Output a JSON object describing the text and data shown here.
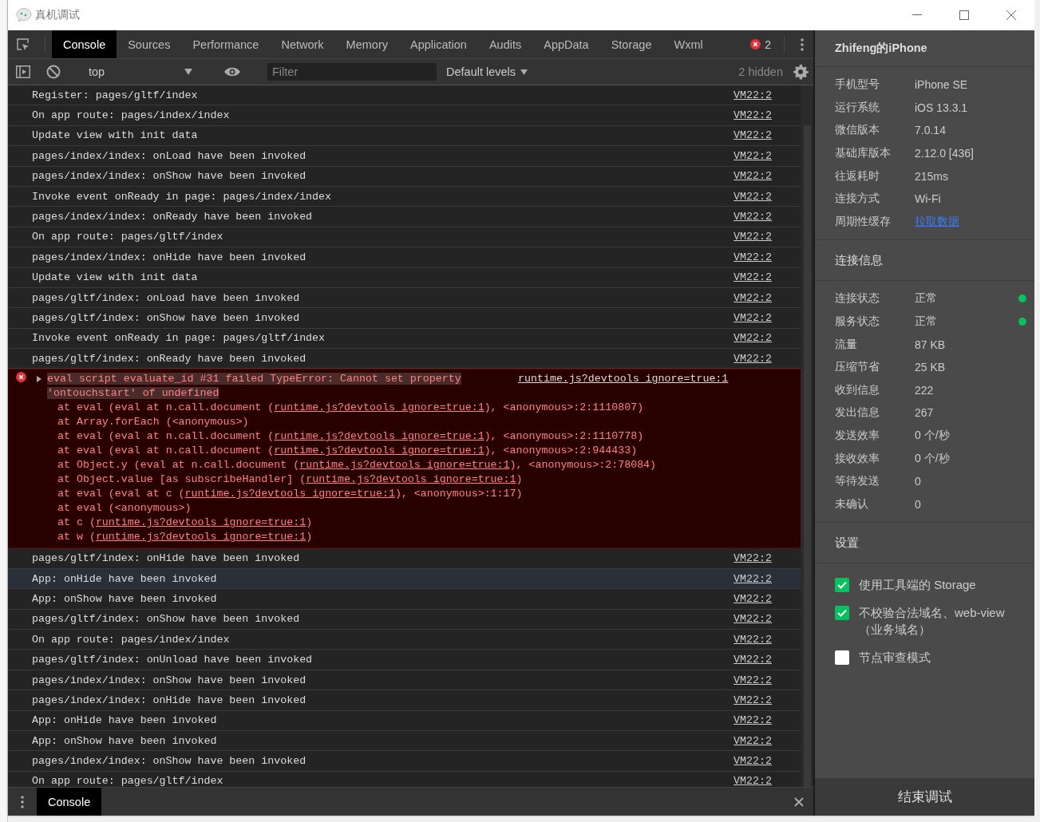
{
  "window": {
    "title": "真机调试"
  },
  "tabs": [
    {
      "label": "Console",
      "selected": true
    },
    {
      "label": "Sources",
      "selected": false
    },
    {
      "label": "Performance",
      "selected": false
    },
    {
      "label": "Network",
      "selected": false
    },
    {
      "label": "Memory",
      "selected": false
    },
    {
      "label": "Application",
      "selected": false
    },
    {
      "label": "Audits",
      "selected": false
    },
    {
      "label": "AppData",
      "selected": false
    },
    {
      "label": "Storage",
      "selected": false
    },
    {
      "label": "Wxml",
      "selected": false
    }
  ],
  "error_count": "2",
  "console_toolbar": {
    "context": "top",
    "filter": {
      "placeholder": "Filter"
    },
    "levels": "Default levels",
    "hidden": "2 hidden"
  },
  "logs": [
    {
      "kind": "log",
      "text": "Register: pages/gltf/index",
      "source": "VM22:2",
      "selected": false
    },
    {
      "kind": "log",
      "text": "On app route: pages/index/index",
      "source": "VM22:2",
      "selected": false
    },
    {
      "kind": "log",
      "text": "Update view with init data",
      "source": "VM22:2",
      "selected": false
    },
    {
      "kind": "log",
      "text": "pages/index/index: onLoad have been invoked",
      "source": "VM22:2",
      "selected": false
    },
    {
      "kind": "log",
      "text": "pages/index/index: onShow have been invoked",
      "source": "VM22:2",
      "selected": false
    },
    {
      "kind": "log",
      "text": "Invoke event onReady in page: pages/index/index",
      "source": "VM22:2",
      "selected": false
    },
    {
      "kind": "log",
      "text": "pages/index/index: onReady have been invoked",
      "source": "VM22:2",
      "selected": false
    },
    {
      "kind": "log",
      "text": "On app route: pages/gltf/index",
      "source": "VM22:2",
      "selected": false
    },
    {
      "kind": "log",
      "text": "pages/index/index: onHide have been invoked",
      "source": "VM22:2",
      "selected": false
    },
    {
      "kind": "log",
      "text": "Update view with init data",
      "source": "VM22:2",
      "selected": false
    },
    {
      "kind": "log",
      "text": "pages/gltf/index: onLoad have been invoked",
      "source": "VM22:2",
      "selected": false
    },
    {
      "kind": "log",
      "text": "pages/gltf/index: onShow have been invoked",
      "source": "VM22:2",
      "selected": false
    },
    {
      "kind": "log",
      "text": "Invoke event onReady in page: pages/gltf/index",
      "source": "VM22:2",
      "selected": false
    },
    {
      "kind": "log",
      "text": "pages/gltf/index: onReady have been invoked",
      "source": "VM22:2",
      "selected": false
    },
    {
      "kind": "error",
      "text": "eval script evaluate_id #31 failed TypeError: Cannot set property 'ontouchstart' of undefined",
      "source": "runtime.js?devtools_ignore=true:1",
      "selected": false,
      "stack": [
        {
          "before": "at eval (eval at n.call.document (",
          "link": "runtime.js?devtools_ignore=true:1",
          "after": "), <anonymous>:2:1110807)"
        },
        {
          "before": "at Array.forEach (<anonymous>)"
        },
        {
          "before": "at eval (eval at n.call.document (",
          "link": "runtime.js?devtools_ignore=true:1",
          "after": "), <anonymous>:2:1110778)"
        },
        {
          "before": "at eval (eval at n.call.document (",
          "link": "runtime.js?devtools_ignore=true:1",
          "after": "), <anonymous>:2:944433)"
        },
        {
          "before": "at Object.y (eval at n.call.document (",
          "link": "runtime.js?devtools_ignore=true:1",
          "after": "), <anonymous>:2:78084)"
        },
        {
          "before": "at Object.value [as subscribeHandler] (",
          "link": "runtime.js?devtools_ignore=true:1",
          "after": ")"
        },
        {
          "before": "at eval (eval at c (",
          "link": "runtime.js?devtools_ignore=true:1",
          "after": "), <anonymous>:1:17)"
        },
        {
          "before": "at eval (<anonymous>)"
        },
        {
          "before": "at c (",
          "link": "runtime.js?devtools_ignore=true:1",
          "after": ")"
        },
        {
          "before": "at w (",
          "link": "runtime.js?devtools_ignore=true:1",
          "after": ")"
        }
      ]
    },
    {
      "kind": "log",
      "text": "pages/gltf/index: onHide have been invoked",
      "source": "VM22:2",
      "selected": false
    },
    {
      "kind": "log",
      "text": "App: onHide have been invoked",
      "source": "VM22:2",
      "selected": true
    },
    {
      "kind": "log",
      "text": "App: onShow have been invoked",
      "source": "VM22:2",
      "selected": false
    },
    {
      "kind": "log",
      "text": "pages/gltf/index: onShow have been invoked",
      "source": "VM22:2",
      "selected": false
    },
    {
      "kind": "log",
      "text": "On app route: pages/index/index",
      "source": "VM22:2",
      "selected": false
    },
    {
      "kind": "log",
      "text": "pages/gltf/index: onUnload have been invoked",
      "source": "VM22:2",
      "selected": false
    },
    {
      "kind": "log",
      "text": "pages/index/index: onShow have been invoked",
      "source": "VM22:2",
      "selected": false
    },
    {
      "kind": "log",
      "text": "pages/index/index: onHide have been invoked",
      "source": "VM22:2",
      "selected": false
    },
    {
      "kind": "log",
      "text": "App: onHide have been invoked",
      "source": "VM22:2",
      "selected": false
    },
    {
      "kind": "log",
      "text": "App: onShow have been invoked",
      "source": "VM22:2",
      "selected": false
    },
    {
      "kind": "log",
      "text": "pages/index/index: onShow have been invoked",
      "source": "VM22:2",
      "selected": false
    },
    {
      "kind": "log",
      "text": "On app route: pages/gltf/index",
      "source": "VM22:2",
      "selected": false
    }
  ],
  "drawer": {
    "tab": "Console"
  },
  "device_panel": {
    "device_name": "Zhifeng的iPhone",
    "info": [
      {
        "kind": "text",
        "label": "手机型号",
        "value": "iPhone SE"
      },
      {
        "kind": "text",
        "label": "运行系统",
        "value": "iOS 13.3.1"
      },
      {
        "kind": "text",
        "label": "微信版本",
        "value": "7.0.14"
      },
      {
        "kind": "text",
        "label": "基础库版本",
        "value": "2.12.0 [436]"
      },
      {
        "kind": "text",
        "label": "往返耗时",
        "value": "215ms"
      },
      {
        "kind": "text",
        "label": "连接方式",
        "value": "Wi-Fi"
      },
      {
        "kind": "link",
        "label": "周期性缓存",
        "value": "拉取数据"
      }
    ],
    "connection_title": "连接信息",
    "connection": [
      {
        "label": "连接状态",
        "value": "正常",
        "color": "#07c160"
      },
      {
        "label": "服务状态",
        "value": "正常",
        "color": "#07c160"
      },
      {
        "label": "流量",
        "value": "87 KB"
      },
      {
        "label": "压缩节省",
        "value": "25 KB"
      },
      {
        "label": "收到信息",
        "value": "222"
      },
      {
        "label": "发出信息",
        "value": "267"
      },
      {
        "label": "发送效率",
        "value": "0 个/秒"
      },
      {
        "label": "接收效率",
        "value": "0 个/秒"
      },
      {
        "label": "等待发送",
        "value": "0"
      },
      {
        "label": "未确认",
        "value": "0"
      }
    ],
    "settings_title": "设置",
    "settings": [
      {
        "label": "使用工具端的 Storage",
        "checked": true
      },
      {
        "label": "不校验合法域名、web-view（业务域名）",
        "checked": true
      },
      {
        "label": "节点审查模式",
        "checked": false
      }
    ],
    "end_button": "结束调试"
  }
}
